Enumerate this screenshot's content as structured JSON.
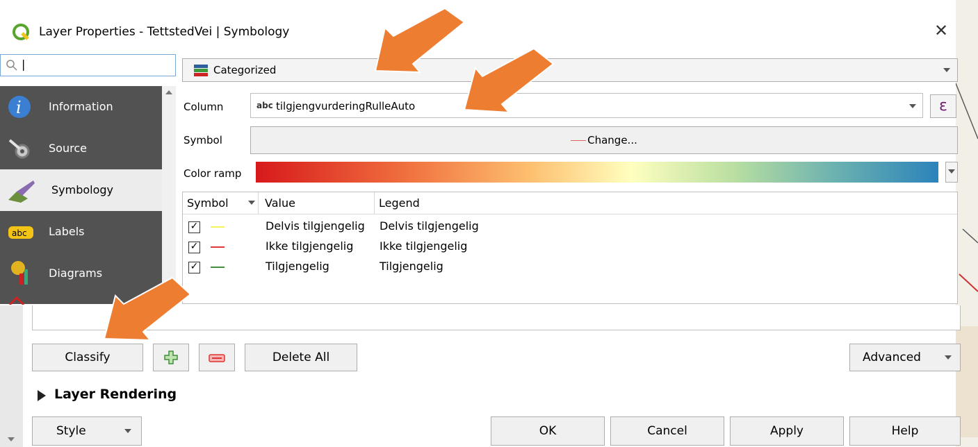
{
  "window": {
    "title": "Layer Properties - TettstedVei | Symbology",
    "close": "✕"
  },
  "search": {
    "value": "",
    "placeholder": ""
  },
  "sidebar": {
    "items": [
      {
        "label": "Information",
        "icon": "info-icon"
      },
      {
        "label": "Source",
        "icon": "source-tools-icon"
      },
      {
        "label": "Symbology",
        "icon": "symbology-brush-icon",
        "selected": true
      },
      {
        "label": "Labels",
        "icon": "labels-abc-icon"
      },
      {
        "label": "Diagrams",
        "icon": "diagrams-icon"
      }
    ]
  },
  "renderer": {
    "selected": "Categorized"
  },
  "column": {
    "label": "Column",
    "type_prefix": "abc",
    "value": "tilgjengvurderingRulleAuto",
    "expr_button": "ε"
  },
  "symbol": {
    "label": "Symbol",
    "button": "Change..."
  },
  "color_ramp": {
    "label": "Color ramp"
  },
  "table": {
    "headers": {
      "symbol": "Symbol",
      "value": "Value",
      "legend": "Legend"
    },
    "rows": [
      {
        "checked": true,
        "check": "✓",
        "color": "#f3f35a",
        "value": "Delvis tilgjengelig",
        "legend": "Delvis tilgjengelig"
      },
      {
        "checked": true,
        "check": "✓",
        "color": "#e0383a",
        "value": "Ikke tilgjengelig",
        "legend": "Ikke tilgjengelig"
      },
      {
        "checked": true,
        "check": "✓",
        "color": "#3f8f3a",
        "value": "Tilgjengelig",
        "legend": "Tilgjengelig"
      }
    ]
  },
  "actions": {
    "classify": "Classify",
    "delete_all": "Delete All",
    "advanced": "Advanced"
  },
  "layer_rendering": {
    "label": "Layer Rendering"
  },
  "footer": {
    "style": "Style",
    "ok": "OK",
    "cancel": "Cancel",
    "apply": "Apply",
    "help": "Help"
  },
  "colors": {
    "arrow": "#ed7d31",
    "sidebar_bg": "#525252"
  }
}
